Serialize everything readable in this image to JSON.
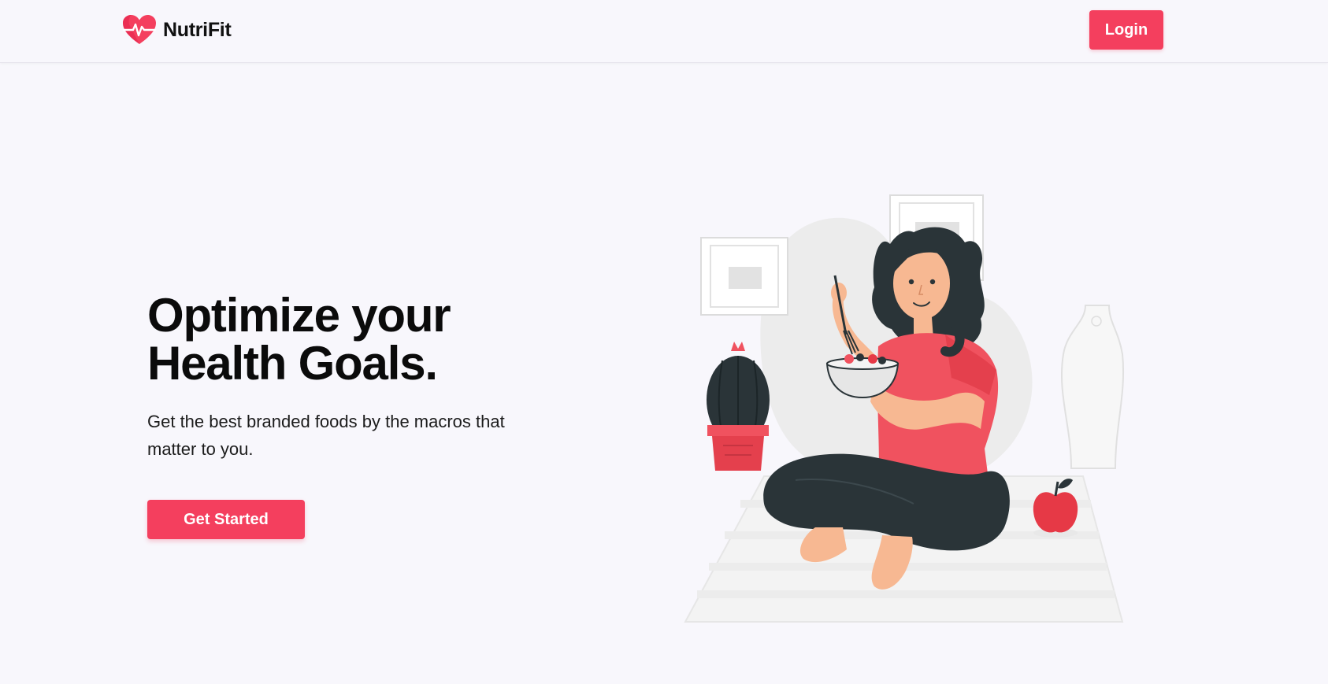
{
  "nav": {
    "brand_name": "NutriFit",
    "login_label": "Login"
  },
  "hero": {
    "title_line1": "Optimize your",
    "title_line2": "Health Goals.",
    "subtitle": "Get the best branded foods by the macros that matter to you.",
    "cta_label": "Get Started"
  },
  "colors": {
    "accent": "#f43f5e",
    "background": "#f8f7fc",
    "illustration_red": "#f0525f",
    "illustration_dark": "#2a3438",
    "skin": "#f7b892"
  },
  "icons": {
    "logo": "heart-pulse-icon"
  }
}
